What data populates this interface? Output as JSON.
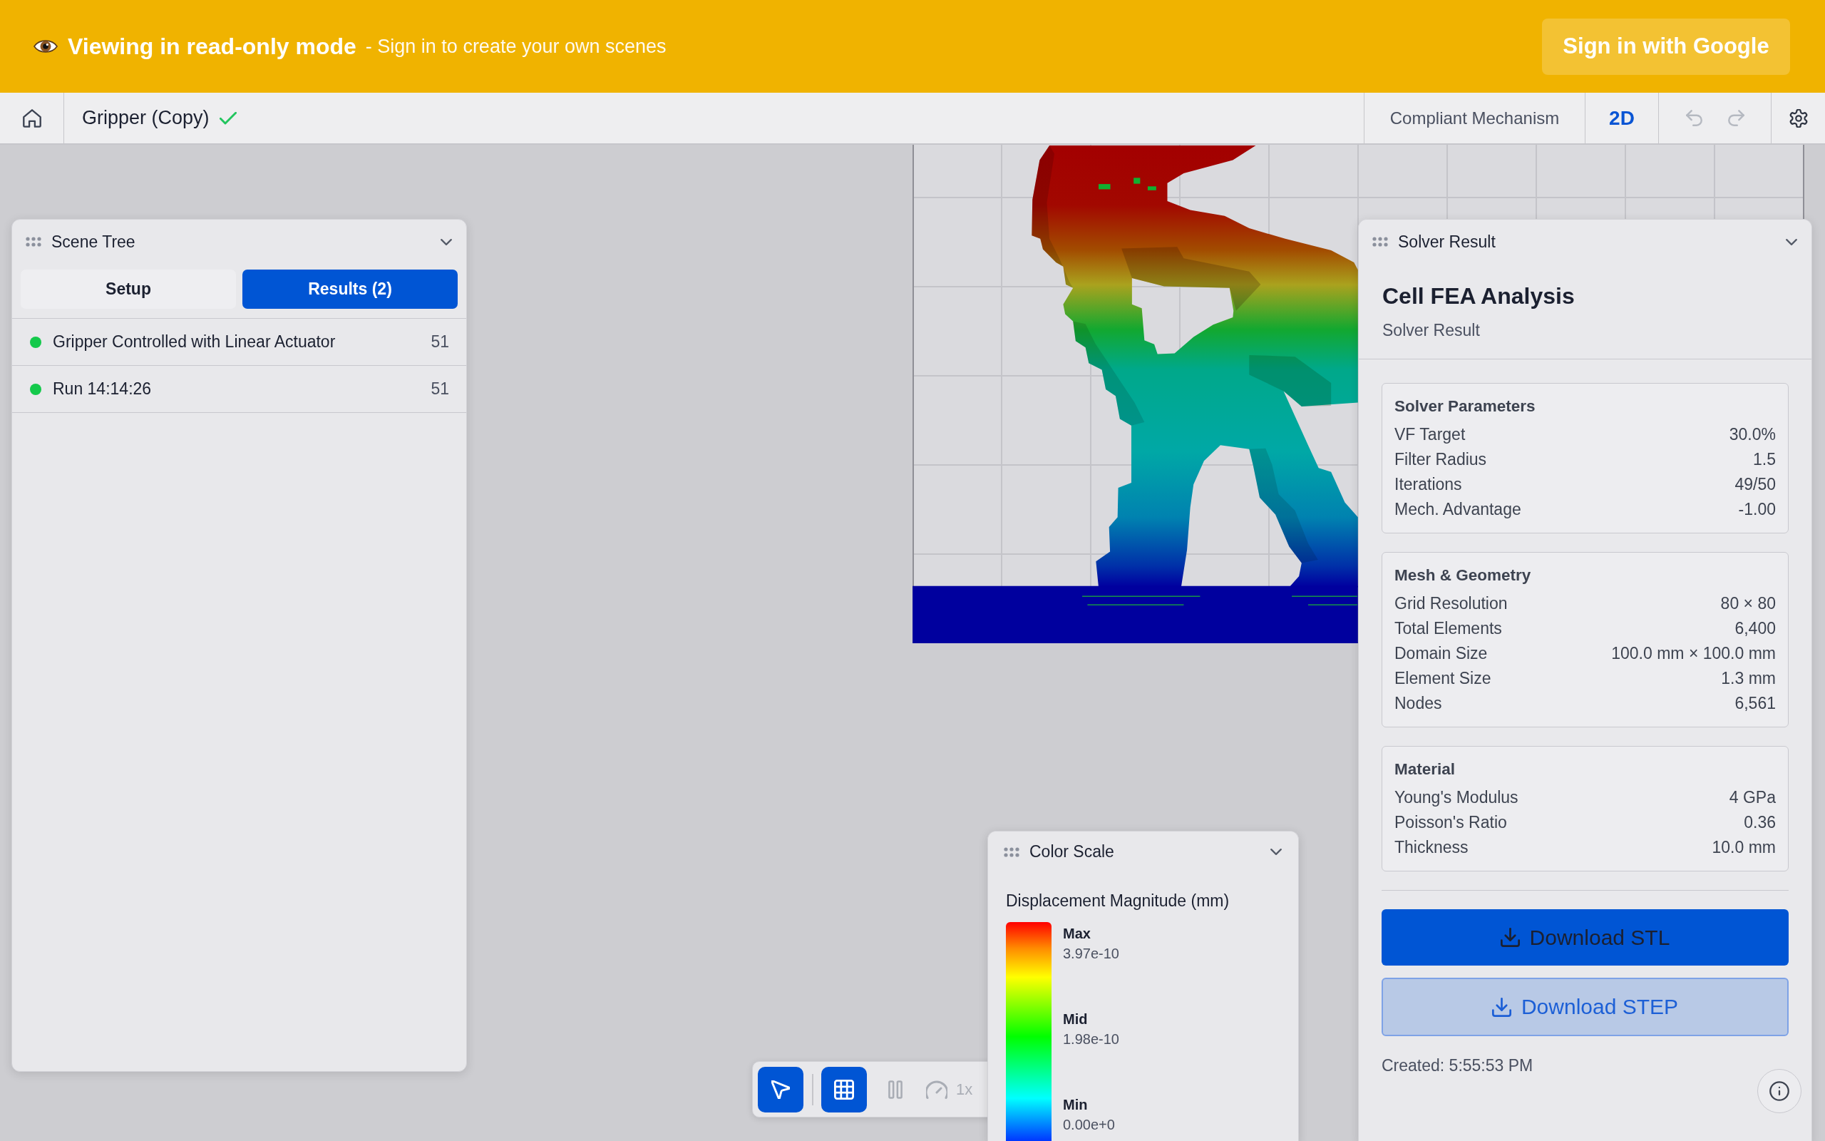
{
  "banner": {
    "title": "Viewing in read-only mode",
    "message": "- Sign in to create your own scenes",
    "sign_in_button": "Sign in with Google"
  },
  "header": {
    "title": "Gripper (Copy)",
    "saved": true,
    "mode": "Compliant Mechanism",
    "view": "2D",
    "history": [
      {
        "kind": "undo",
        "disabled": true
      },
      {
        "kind": "redo",
        "disabled": true
      }
    ]
  },
  "scene_tree": {
    "title": "Scene Tree",
    "tabs": [
      {
        "label": "Setup",
        "selected": false
      },
      {
        "label": "Results (2)",
        "selected": true
      }
    ],
    "items": [
      {
        "name": "Gripper Controlled with Linear Actuator",
        "count": "51",
        "color": "#14c94b"
      },
      {
        "name": "Run 14:14:26",
        "count": "51",
        "color": "#14c94b"
      }
    ]
  },
  "solver_result": {
    "title": "Solver Result",
    "heading": "Cell FEA Analysis",
    "subheading": "Solver Result",
    "sections": [
      {
        "title": "Solver Parameters",
        "rows": [
          {
            "label": "VF Target",
            "value": "30.0%"
          },
          {
            "label": "Filter Radius",
            "value": "1.5"
          },
          {
            "label": "Iterations",
            "value": "49/50"
          },
          {
            "label": "Mech. Advantage",
            "value": "-1.00"
          }
        ]
      },
      {
        "title": "Mesh & Geometry",
        "rows": [
          {
            "label": "Grid Resolution",
            "value": "80 × 80"
          },
          {
            "label": "Total Elements",
            "value": "6,400"
          },
          {
            "label": "Domain Size",
            "value": "100.0 mm × 100.0 mm"
          },
          {
            "label": "Element Size",
            "value": "1.3 mm"
          },
          {
            "label": "Nodes",
            "value": "6,561"
          }
        ]
      },
      {
        "title": "Material",
        "rows": [
          {
            "label": "Young's Modulus",
            "value": "4 GPa"
          },
          {
            "label": "Poisson's Ratio",
            "value": "0.36"
          },
          {
            "label": "Thickness",
            "value": "10.0 mm"
          }
        ]
      }
    ],
    "buttons": [
      {
        "label": "Download STL",
        "kind": "primary"
      },
      {
        "label": "Download STEP",
        "kind": "secondary"
      }
    ],
    "created": "Created: 5:55:53 PM"
  },
  "color_scale": {
    "title": "Color Scale",
    "quantity": "Displacement Magnitude (mm)",
    "stops": [
      {
        "label": "Max",
        "value": "3.97e-10"
      },
      {
        "label": "Mid",
        "value": "1.98e-10"
      },
      {
        "label": "Min",
        "value": "0.00e+0"
      }
    ]
  },
  "view_toolbar": {
    "tools": [
      {
        "kind": "select",
        "selected": true,
        "disabled": false
      },
      {
        "kind": "grid",
        "selected": true,
        "disabled": false
      },
      {
        "kind": "pause",
        "selected": false,
        "disabled": true
      },
      {
        "kind": "speed",
        "label": "1x",
        "selected": false,
        "disabled": true
      }
    ]
  }
}
